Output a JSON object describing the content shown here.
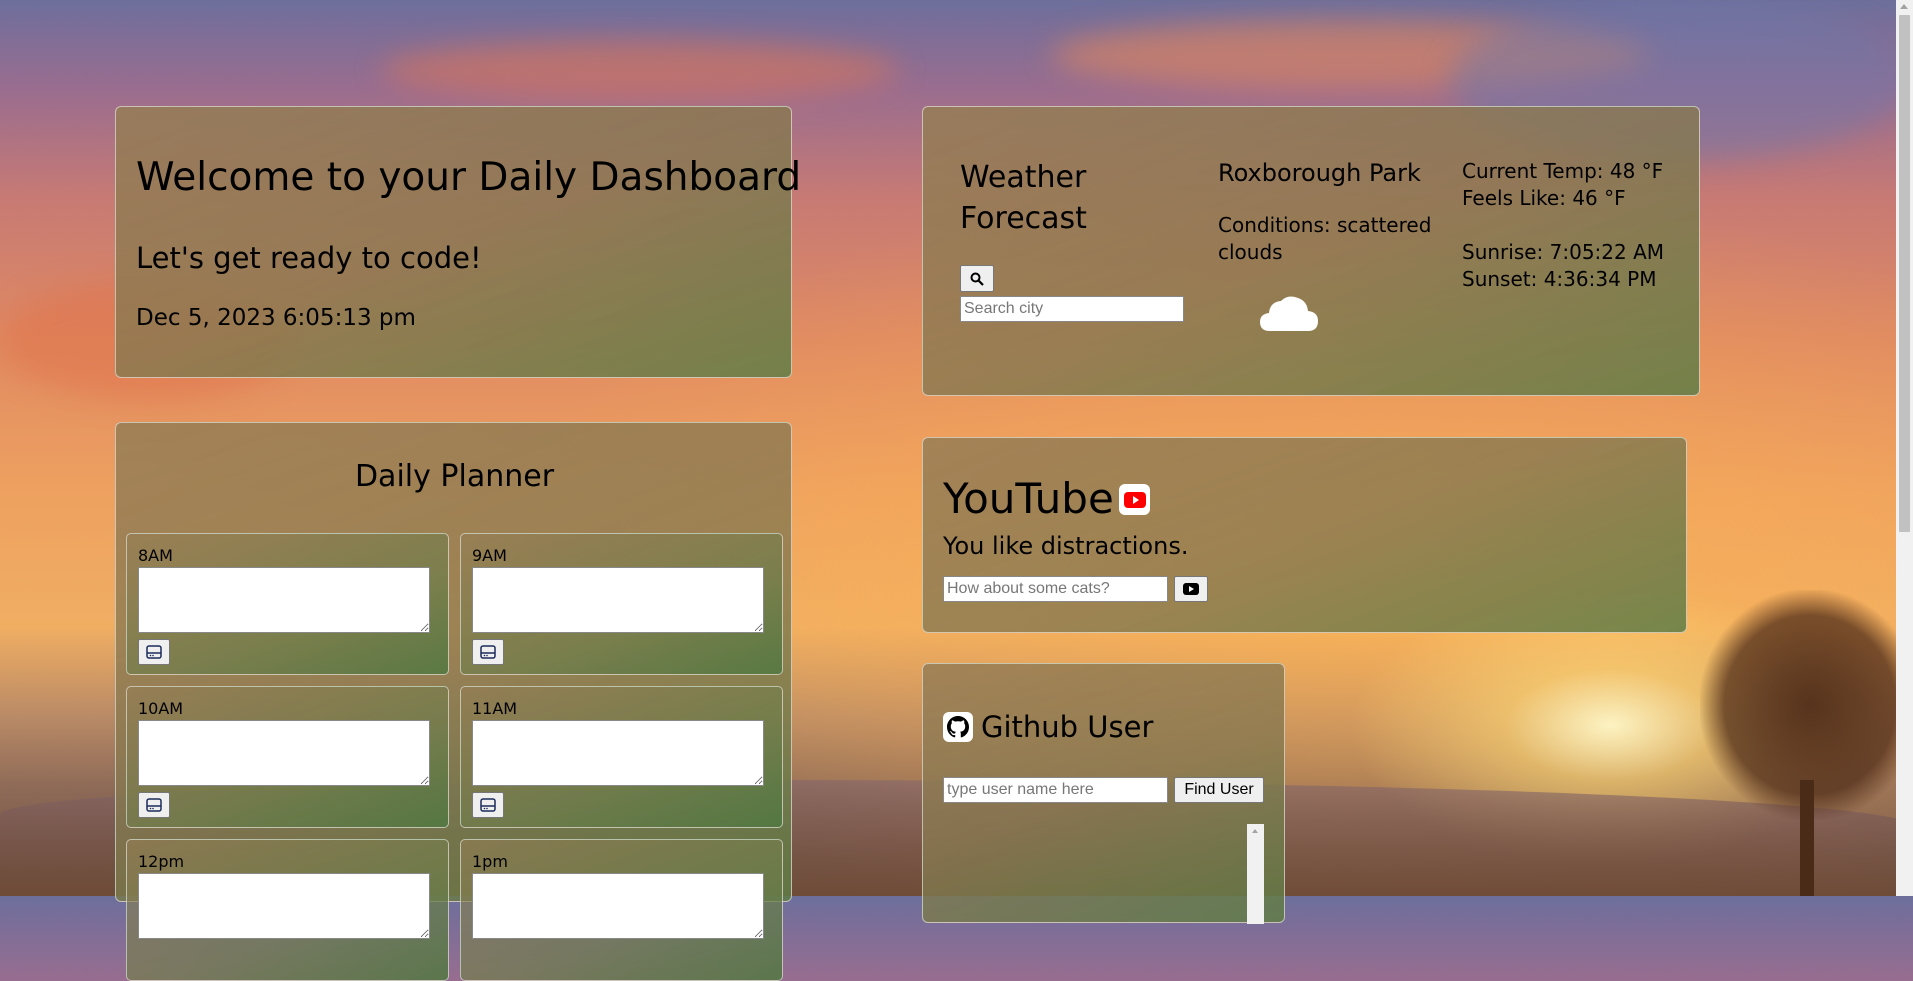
{
  "welcome": {
    "title": "Welcome to your Daily Dashboard",
    "subtitle": "Let's get ready to code!",
    "datetime": "Dec 5, 2023 6:05:13 pm"
  },
  "planner": {
    "title": "Daily Planner",
    "slots": [
      {
        "time": "8AM"
      },
      {
        "time": "9AM"
      },
      {
        "time": "10AM"
      },
      {
        "time": "11AM"
      },
      {
        "time": "12pm"
      },
      {
        "time": "1pm"
      }
    ],
    "save_icon": "save-icon"
  },
  "weather": {
    "title_line1": "Weather",
    "title_line2": "Forecast",
    "search_icon": "search-icon",
    "search_placeholder": "Search city",
    "location": "Roxborough Park",
    "conditions_line1": "Conditions: scattered",
    "conditions_line2": "clouds",
    "condition_icon": "cloud-icon",
    "current_temp": "Current Temp: 48 °F",
    "feels_like": "Feels Like: 46 °F",
    "sunrise": "Sunrise: 7:05:22 AM",
    "sunset": "Sunset: 4:36:34 PM"
  },
  "youtube": {
    "title": "YouTube",
    "logo_icon": "youtube-logo-icon",
    "tagline": "You like distractions.",
    "search_placeholder": "How about some cats?",
    "play_icon": "youtube-play-icon"
  },
  "github": {
    "title": "Github User",
    "logo_icon": "github-icon",
    "search_placeholder": "type user name here",
    "button_label": "Find User"
  },
  "colors": {
    "youtube_red": "#ff0000",
    "card_border": "#ffffff"
  }
}
